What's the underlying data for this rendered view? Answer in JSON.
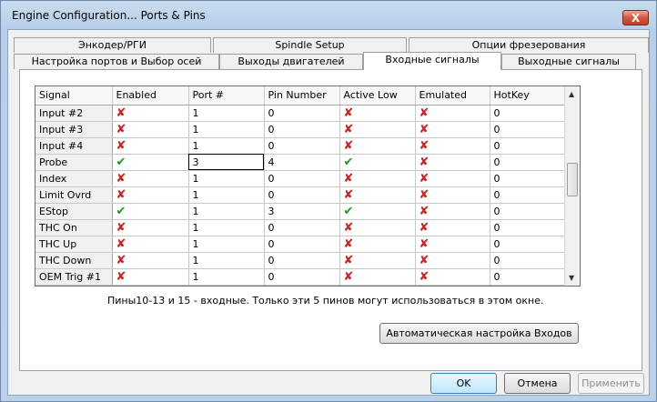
{
  "window": {
    "title": "Engine Configuration... Ports & Pins",
    "close_glyph": "X"
  },
  "tabs_back": [
    "Энкодер/РГИ",
    "Spindle Setup",
    "Опции фрезерования"
  ],
  "tabs_front": [
    "Настройка портов и Выбор осей",
    "Выходы двигателей",
    "Входные сигналы",
    "Выходные сигналы"
  ],
  "active_tab": "Входные сигналы",
  "table": {
    "columns": [
      "Signal",
      "Enabled",
      "Port #",
      "Pin Number",
      "Active Low",
      "Emulated",
      "HotKey"
    ],
    "rows": [
      {
        "signal": "Input #2",
        "enabled": "x",
        "port": "1",
        "pin": "0",
        "active_low": "x",
        "emulated": "x",
        "hotkey": "0"
      },
      {
        "signal": "Input #3",
        "enabled": "x",
        "port": "1",
        "pin": "0",
        "active_low": "x",
        "emulated": "x",
        "hotkey": "0"
      },
      {
        "signal": "Input #4",
        "enabled": "x",
        "port": "1",
        "pin": "0",
        "active_low": "x",
        "emulated": "x",
        "hotkey": "0"
      },
      {
        "signal": "Probe",
        "enabled": "check",
        "port": "3",
        "pin": "4",
        "active_low": "check",
        "emulated": "x",
        "hotkey": "0"
      },
      {
        "signal": "Index",
        "enabled": "x",
        "port": "1",
        "pin": "0",
        "active_low": "x",
        "emulated": "x",
        "hotkey": "0"
      },
      {
        "signal": "Limit Ovrd",
        "enabled": "x",
        "port": "1",
        "pin": "0",
        "active_low": "x",
        "emulated": "x",
        "hotkey": "0"
      },
      {
        "signal": "EStop",
        "enabled": "check",
        "port": "1",
        "pin": "3",
        "active_low": "check",
        "emulated": "x",
        "hotkey": "0"
      },
      {
        "signal": "THC On",
        "enabled": "x",
        "port": "1",
        "pin": "0",
        "active_low": "x",
        "emulated": "x",
        "hotkey": "0"
      },
      {
        "signal": "THC Up",
        "enabled": "x",
        "port": "1",
        "pin": "0",
        "active_low": "x",
        "emulated": "x",
        "hotkey": "0"
      },
      {
        "signal": "THC Down",
        "enabled": "x",
        "port": "1",
        "pin": "0",
        "active_low": "x",
        "emulated": "x",
        "hotkey": "0"
      },
      {
        "signal": "OEM Trig #1",
        "enabled": "x",
        "port": "1",
        "pin": "0",
        "active_low": "x",
        "emulated": "x",
        "hotkey": "0"
      }
    ]
  },
  "note": "Пины10-13 и 15 - входные. Только эти 5 пинов могут использоваться в этом окне.",
  "buttons": {
    "auto": "Автоматическая настройка Входов",
    "ok": "OK",
    "cancel": "Отмена",
    "apply": "Применить"
  },
  "icons": {
    "x": "✘",
    "check": "✔"
  }
}
